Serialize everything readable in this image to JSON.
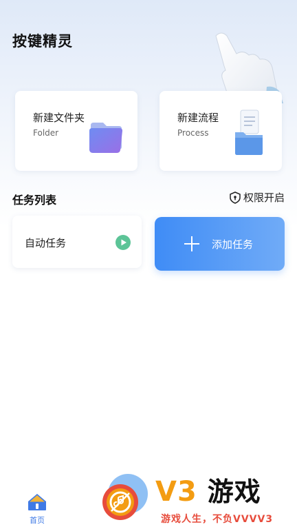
{
  "app": {
    "title": "按键精灵"
  },
  "cards": {
    "folder": {
      "title": "新建文件夹",
      "subtitle": "Folder"
    },
    "process": {
      "title": "新建流程",
      "subtitle": "Process"
    }
  },
  "tasks": {
    "section_title": "任务列表",
    "permission_label": "权限开启",
    "auto_task_label": "自动任务",
    "add_task_label": "添加任务"
  },
  "bottom_nav": {
    "home_label": "首页"
  },
  "watermark": {
    "brand": "V3",
    "brand_cn": "游戏",
    "slogan": "游戏人生，不负VVVV3"
  },
  "colors": {
    "accent": "#3f8cf6",
    "play": "#5cc497",
    "watermark_orange": "#f39c12",
    "watermark_red": "#e74c3c"
  }
}
